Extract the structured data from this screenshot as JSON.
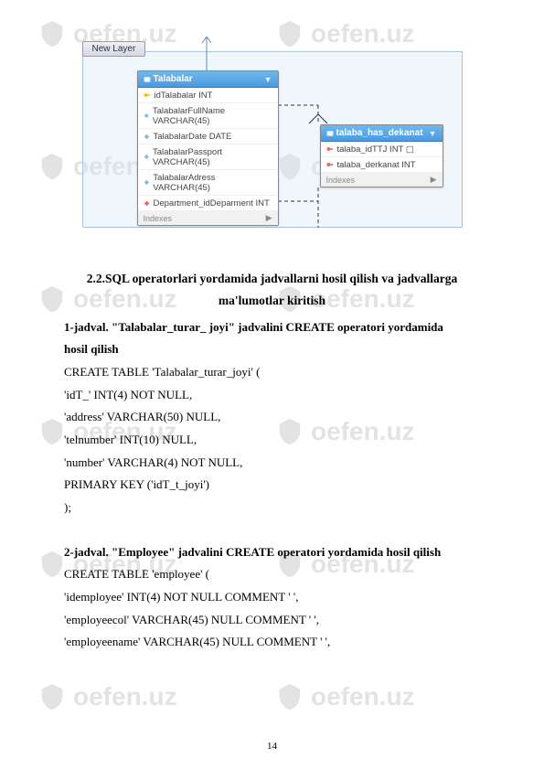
{
  "watermark_text": "oefen.uz",
  "diagram": {
    "layer_label": "New Layer",
    "table1": {
      "name": "Talabalar",
      "rows": [
        {
          "icon": "key",
          "text": "idTalabalar INT"
        },
        {
          "icon": "diamond",
          "text": "TalabalarFullName VARCHAR(45)"
        },
        {
          "icon": "diamond",
          "text": "TalabalarDate DATE"
        },
        {
          "icon": "diamond",
          "text": "TalabalarPassport VARCHAR(45)"
        },
        {
          "icon": "diamond",
          "text": "TalabalarAdress VARCHAR(45)"
        },
        {
          "icon": "diamond-red",
          "text": "Department_idDeparment INT"
        }
      ],
      "footer": "Indexes"
    },
    "table2": {
      "name": "talaba_has_dekanat",
      "rows": [
        {
          "icon": "key-red",
          "text": "talaba_idTTJ INT ▢"
        },
        {
          "icon": "key-red",
          "text": "talaba_derkanat INT"
        }
      ],
      "footer": "Indexes"
    }
  },
  "section_heading_l1": "2.2.SQL operatorlari yordamida jadvallarni hosil qilish va  jadvallarga",
  "section_heading_l2": "ma'lumotlar kiritish",
  "block1_title_l1": "1-jadval. \"Talabalar_turar_ joyi\" jadvalini CREATE operatori yordamida",
  "block1_title_l2": "hosil qilish",
  "code1": [
    "CREATE TABLE 'Talabalar_turar_joyi' (",
    "'idT_' INT(4) NOT NULL,",
    "'address' VARCHAR(50) NULL,",
    "'telnumber' INT(10) NULL,",
    "'number'  VARCHAR(4) NOT NULL,",
    "PRIMARY KEY ('idT_t_joyi')",
    ");"
  ],
  "block2_title": "2-jadval. \"Employee\" jadvalini CREATE operatori yordamida hosil qilish",
  "code2": [
    "CREATE TABLE 'employee' (",
    "'idemployee' INT(4) NOT NULL COMMENT ' ',",
    "'employeecol' VARCHAR(45) NULL COMMENT ' ',",
    "'employeename' VARCHAR(45) NULL COMMENT ' ',"
  ],
  "page_number": "14"
}
